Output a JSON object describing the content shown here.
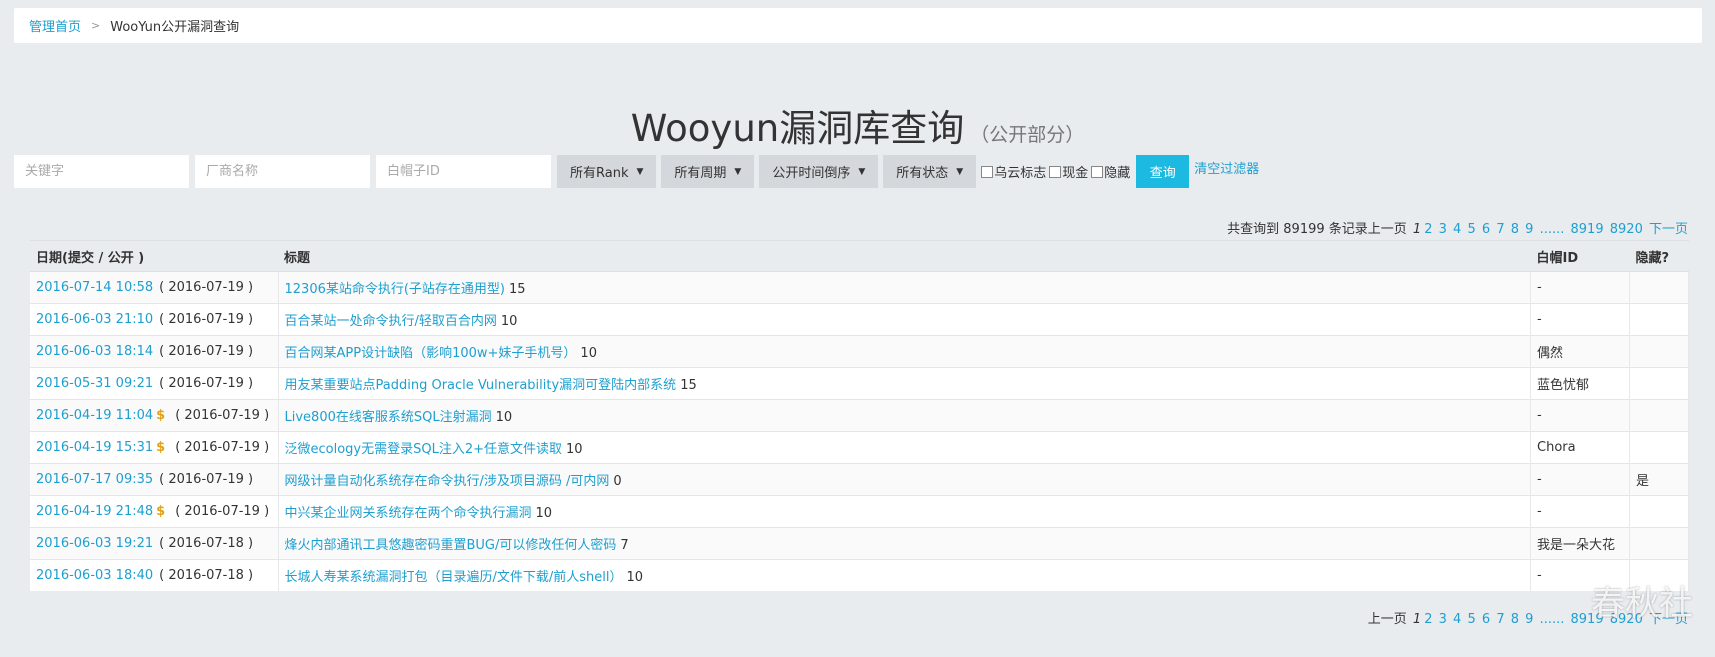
{
  "breadcrumb": {
    "home": "管理首页",
    "current": "WooYun公开漏洞查询"
  },
  "heading": {
    "title": "Wooyun漏洞库查询",
    "subtitle": "（公开部分）"
  },
  "filters": {
    "keyword_placeholder": "关键字",
    "vendor_placeholder": "厂商名称",
    "whitehat_placeholder": "白帽子ID",
    "rank": "所有Rank",
    "period": "所有周期",
    "order": "公开时间倒序",
    "status": "所有状态",
    "chk_wooyun": "乌云标志",
    "chk_cash": "现金",
    "chk_hidden": "隐藏",
    "query_btn": "查询",
    "clear_link": "清空过滤器"
  },
  "pager_top": {
    "summary": "共查询到 89199 条记录",
    "prev": "上一页",
    "current": "1",
    "pages": [
      "2",
      "3",
      "4",
      "5",
      "6",
      "7",
      "8",
      "9"
    ],
    "ellipsis": "......",
    "last1": "8919",
    "last2": "8920",
    "next": "下一页"
  },
  "pager_bottom": {
    "prev": "上一页",
    "current": "1",
    "pages": [
      "2",
      "3",
      "4",
      "5",
      "6",
      "7",
      "8",
      "9"
    ],
    "ellipsis": "......",
    "last1": "8919",
    "last2": "8920",
    "next": "下一页"
  },
  "table": {
    "headers": [
      "日期(提交 / 公开 )",
      "标题",
      "白帽ID",
      "隐藏?"
    ],
    "rows": [
      {
        "submit": "2016-07-14 10:58",
        "cash": false,
        "public": "( 2016-07-19 )",
        "title": "12306某站命令执行(子站存在通用型)",
        "rank": "15",
        "whitehat": "-",
        "hidden": ""
      },
      {
        "submit": "2016-06-03 21:10",
        "cash": false,
        "public": "( 2016-07-19 )",
        "title": "百合某站一处命令执行/轻取百合内网",
        "rank": "10",
        "whitehat": "-",
        "hidden": ""
      },
      {
        "submit": "2016-06-03 18:14",
        "cash": false,
        "public": "( 2016-07-19 )",
        "title": "百合网某APP设计缺陷（影响100w+妹子手机号）",
        "rank": "10",
        "whitehat": "偶然",
        "hidden": ""
      },
      {
        "submit": "2016-05-31 09:21",
        "cash": false,
        "public": "( 2016-07-19 )",
        "title": "用友某重要站点Padding Oracle Vulnerability漏洞可登陆内部系统",
        "rank": "15",
        "whitehat": "蓝色忧郁",
        "hidden": ""
      },
      {
        "submit": "2016-04-19 11:04",
        "cash": true,
        "public": "( 2016-07-19 )",
        "title": "Live800在线客服系统SQL注射漏洞",
        "rank": "10",
        "whitehat": "-",
        "hidden": ""
      },
      {
        "submit": "2016-04-19 15:31",
        "cash": true,
        "public": "( 2016-07-19 )",
        "title": "泛微ecology无需登录SQL注入2+任意文件读取",
        "rank": "10",
        "whitehat": "Chora",
        "hidden": ""
      },
      {
        "submit": "2016-07-17 09:35",
        "cash": false,
        "public": "( 2016-07-19 )",
        "title": "网级计量自动化系统存在命令执行/涉及项目源码 /可内网",
        "rank": "0",
        "whitehat": "-",
        "hidden": "是"
      },
      {
        "submit": "2016-04-19 21:48",
        "cash": true,
        "public": "( 2016-07-19 )",
        "title": "中兴某企业网关系统存在两个命令执行漏洞",
        "rank": "10",
        "whitehat": "-",
        "hidden": ""
      },
      {
        "submit": "2016-06-03 19:21",
        "cash": false,
        "public": "( 2016-07-18 )",
        "title": "烽火内部通讯工具悠趣密码重置BUG/可以修改任何人密码",
        "rank": "7",
        "whitehat": "我是一朵大花",
        "hidden": ""
      },
      {
        "submit": "2016-06-03 18:40",
        "cash": false,
        "public": "( 2016-07-18 )",
        "title": "长城人寿某系统漏洞打包（目录遍历/文件下载/前人shell）",
        "rank": "10",
        "whitehat": "-",
        "hidden": ""
      }
    ]
  },
  "cash_symbol": "$",
  "watermark": "春秋社"
}
